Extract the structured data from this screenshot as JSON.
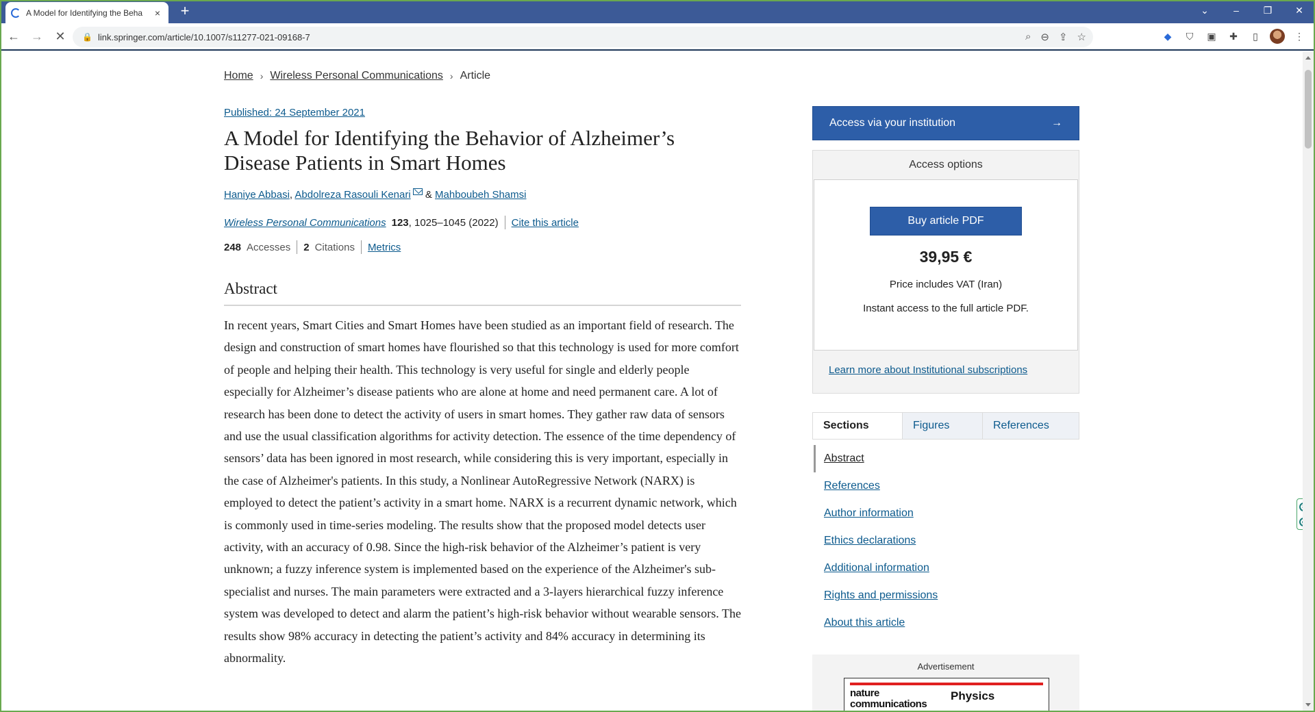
{
  "browser": {
    "tab_title": "A Model for Identifying the Beha",
    "tab_close": "×",
    "new_tab": "+",
    "url": "link.springer.com/article/10.1007/s11277-021-09168-7",
    "window_controls": [
      "⌄",
      "–",
      "❐",
      "✕"
    ]
  },
  "breadcrumb": {
    "home": "Home",
    "journal": "Wireless Personal Communications",
    "current": "Article"
  },
  "article": {
    "published": "Published: 24 September 2021",
    "title": "A Model for Identifying the Behavior of Alzheimer’s Disease Patients in Smart Homes",
    "authors": {
      "author1": "Haniye Abbasi",
      "comma": ",",
      "author2": "Abdolreza Rasouli Kenari",
      "amp": "&",
      "author3": "Mahboubeh Shamsi"
    },
    "journal_name": "Wireless Personal Communications",
    "volume": "123",
    "pages_year": ", 1025–1045 (2022)",
    "cite": "Cite this article",
    "accesses_count": "248",
    "accesses_label": "Accesses",
    "citations_count": "2",
    "citations_label": "Citations",
    "metrics": "Metrics"
  },
  "abstract": {
    "heading": "Abstract",
    "text": "In recent years, Smart Cities and Smart Homes have been studied as an important field of research. The design and construction of smart homes have flourished so that this technology is used for more comfort of people and helping their health. This technology is very useful for single and elderly people especially for Alzheimer’s disease patients who are alone at home and need permanent care. A lot of research has been done to detect the activity of users in smart homes. They gather raw data of sensors and use the usual classification algorithms for activity detection. The essence of the time dependency of sensors’ data has been ignored in most research, while considering this is very important, especially in the case of Alzheimer's patients. In this study, a Nonlinear AutoRegressive Network (NARX) is employed to detect the patient’s activity in a smart home. NARX is a recurrent dynamic network, which is commonly used in time-series modeling. The results show that the proposed model detects user activity, with an accuracy of 0.98. Since the high-risk behavior of the Alzheimer’s patient is very unknown; a fuzzy inference system is implemented based on the experience of the Alzheimer's sub-specialist and nurses. The main parameters were extracted and a 3-layers hierarchical fuzzy inference system was developed to detect and alarm the patient’s high-risk behavior without wearable sensors. The results show 98% accuracy in detecting the patient’s activity and 84% accuracy in determining its abnormality."
  },
  "sidebar": {
    "access_institution": "Access via your institution",
    "access_arrow": "→",
    "access_options": "Access options",
    "buy_pdf": "Buy article PDF",
    "price": "39,95 €",
    "vat": "Price includes VAT (Iran)",
    "instant": "Instant access to the full article PDF.",
    "learn_more": "Learn more about Institutional subscriptions",
    "tabs": [
      "Sections",
      "Figures",
      "References"
    ],
    "toc": [
      "Abstract",
      "References",
      "Author information",
      "Ethics declarations",
      "Additional information",
      "Rights and permissions",
      "About this article"
    ],
    "advertisement": "Advertisement",
    "ad_brand": "nature communications",
    "ad_topic": "Physics"
  }
}
